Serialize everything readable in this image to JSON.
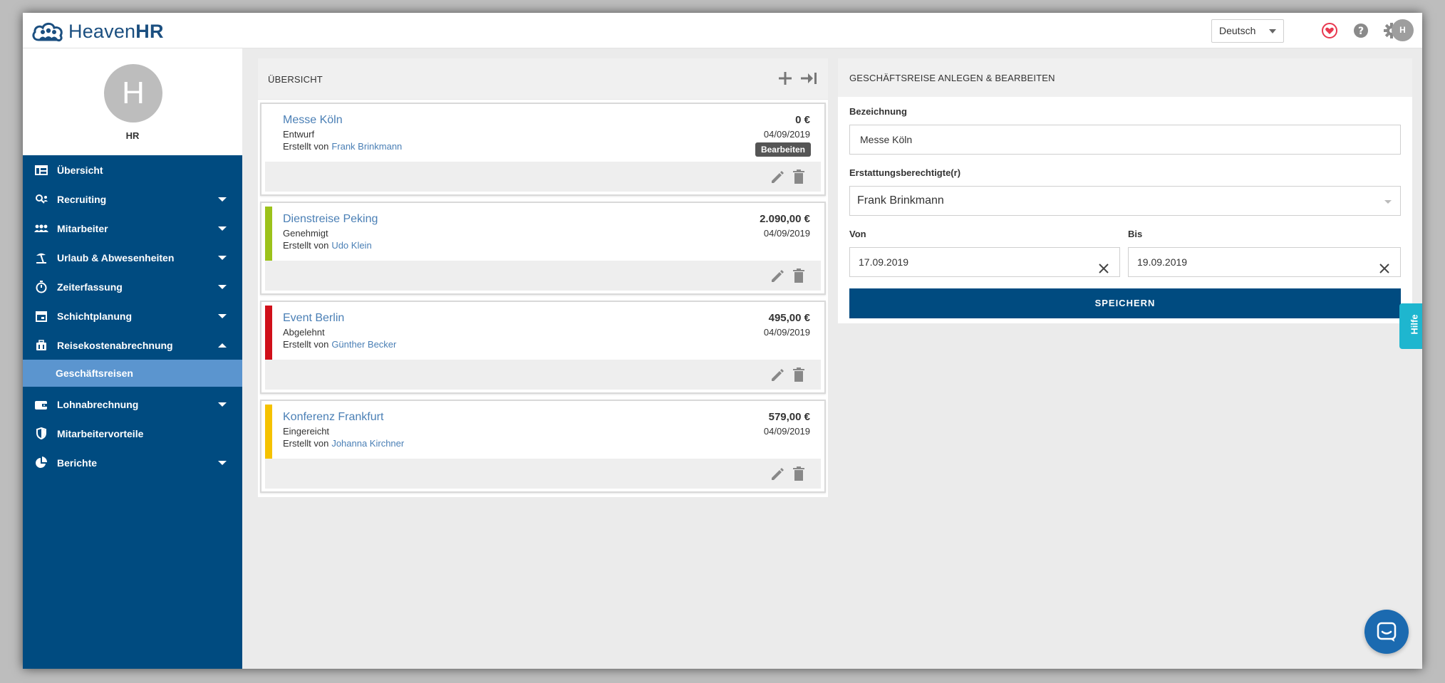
{
  "app": {
    "brand": {
      "name_regular": "Heaven",
      "name_bold": "HR"
    },
    "language": "Deutsch",
    "user_initial": "H"
  },
  "colors": {
    "primary": "#004b80",
    "active_sub": "#5b95cf",
    "link": "#4a7fb5",
    "status_genehmigt": "#9cc21b",
    "status_abgelehnt": "#d0101a",
    "status_eingereicht": "#f5c200",
    "help_tab": "#1eb6cf",
    "heart": "#e8384f"
  },
  "sidebar": {
    "profile": {
      "initial": "H",
      "name": "HR"
    },
    "items": [
      {
        "label": "Übersicht",
        "icon": "dashboard-icon",
        "expandable": false
      },
      {
        "label": "Recruiting",
        "icon": "recruiting-icon",
        "expandable": true
      },
      {
        "label": "Mitarbeiter",
        "icon": "people-icon",
        "expandable": true
      },
      {
        "label": "Urlaub & Abwesenheiten",
        "icon": "beach-icon",
        "expandable": true
      },
      {
        "label": "Zeiterfassung",
        "icon": "stopwatch-icon",
        "expandable": true
      },
      {
        "label": "Schichtplanung",
        "icon": "calendar-icon",
        "expandable": true
      },
      {
        "label": "Reisekostenabrechnung",
        "icon": "luggage-icon",
        "expandable": true,
        "expanded": true
      },
      {
        "label": "Lohnabrechnung",
        "icon": "wallet-icon",
        "expandable": true
      },
      {
        "label": "Mitarbeitervorteile",
        "icon": "shield-icon",
        "expandable": false
      },
      {
        "label": "Berichte",
        "icon": "pie-chart-icon",
        "expandable": true
      }
    ],
    "sub_item": "Geschäftsreisen"
  },
  "overview": {
    "title": "ÜBERSICHT",
    "trips": [
      {
        "title": "Messe Köln",
        "status": "Entwurf",
        "created_by_label": "Erstellt von",
        "created_by": "Frank Brinkmann",
        "amount": "0 €",
        "date": "04/09/2019",
        "status_color": "",
        "tooltip": "Bearbeiten"
      },
      {
        "title": "Dienstreise Peking",
        "status": "Genehmigt",
        "created_by_label": "Erstellt von",
        "created_by": "Udo Klein",
        "amount": "2.090,00 €",
        "date": "04/09/2019",
        "status_color": "#9cc21b"
      },
      {
        "title": "Event Berlin",
        "status": "Abgelehnt",
        "created_by_label": "Erstellt von",
        "created_by": "Günther Becker",
        "amount": "495,00 €",
        "date": "04/09/2019",
        "status_color": "#d0101a"
      },
      {
        "title": "Konferenz Frankfurt",
        "status": "Eingereicht",
        "created_by_label": "Erstellt von",
        "created_by": "Johanna Kirchner",
        "amount": "579,00 €",
        "date": "04/09/2019",
        "status_color": "#f5c200"
      }
    ]
  },
  "form": {
    "title": "GESCHÄFTSREISE ANLEGEN & BEARBEITEN",
    "bezeichnung_label": "Bezeichnung",
    "bezeichnung_value": "Messe Köln",
    "erstattung_label": "Erstattungsberechtigte(r)",
    "erstattung_value": "Frank Brinkmann",
    "von_label": "Von",
    "von_value": "17.09.2019",
    "bis_label": "Bis",
    "bis_value": "19.09.2019",
    "save_label": "SPEICHERN"
  },
  "help_tab": "Hilfe"
}
